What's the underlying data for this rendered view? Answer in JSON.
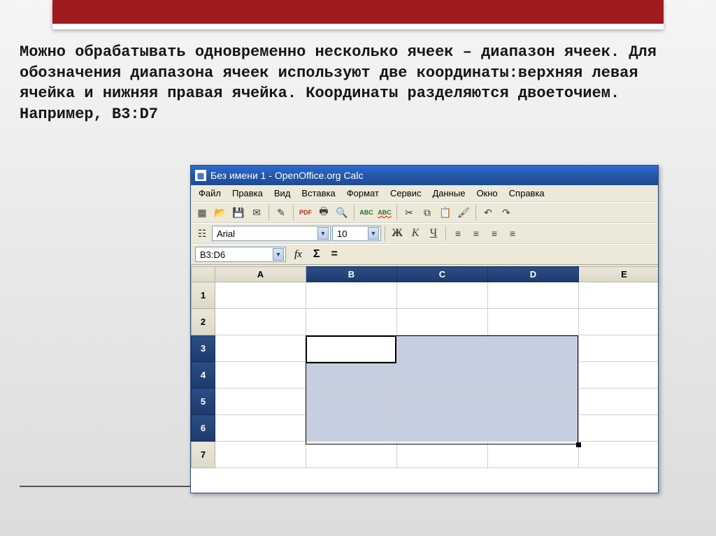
{
  "slide": {
    "text": "Можно обрабатывать одновременно несколько ячеек – диапазон ячеек. Для обозначения диапазона ячеек используют две координаты:верхняя левая ячейка и нижняя правая ячейка. Координаты разделяются двоеточием. Например, B3:D7"
  },
  "window": {
    "title": "Без имени 1 - OpenOffice.org Calc"
  },
  "menu": {
    "file": "Файл",
    "edit": "Правка",
    "view": "Вид",
    "insert": "Вставка",
    "format": "Формат",
    "tools": "Сервис",
    "data": "Данные",
    "window": "Окно",
    "help": "Справка"
  },
  "toolbar_icons": {
    "new": "▦",
    "open": "📂",
    "save": "💾",
    "mail": "✉",
    "edit": "✎",
    "pdf": "PDF",
    "print": "🖶",
    "preview": "🔍",
    "spell": "ABC",
    "autospell": "ABC",
    "cut": "✂",
    "copy": "⧉",
    "paste": "📋",
    "fmtbrush": "🖌",
    "undo": "↶",
    "redo": "↷"
  },
  "format": {
    "font_name": "Arial",
    "font_size": "10",
    "bold": "Ж",
    "italic": "К",
    "underline": "Ч"
  },
  "formula_bar": {
    "name_box": "B3:D6",
    "fx": "fx",
    "sigma": "Σ",
    "eq": "="
  },
  "grid": {
    "columns": [
      "A",
      "B",
      "C",
      "D",
      "E"
    ],
    "rows": [
      "1",
      "2",
      "3",
      "4",
      "5",
      "6",
      "7"
    ],
    "selected_cols": [
      "B",
      "C",
      "D"
    ],
    "selected_rows": [
      "3",
      "4",
      "5",
      "6"
    ],
    "active_cell": "B3",
    "selection": "B3:D6"
  }
}
